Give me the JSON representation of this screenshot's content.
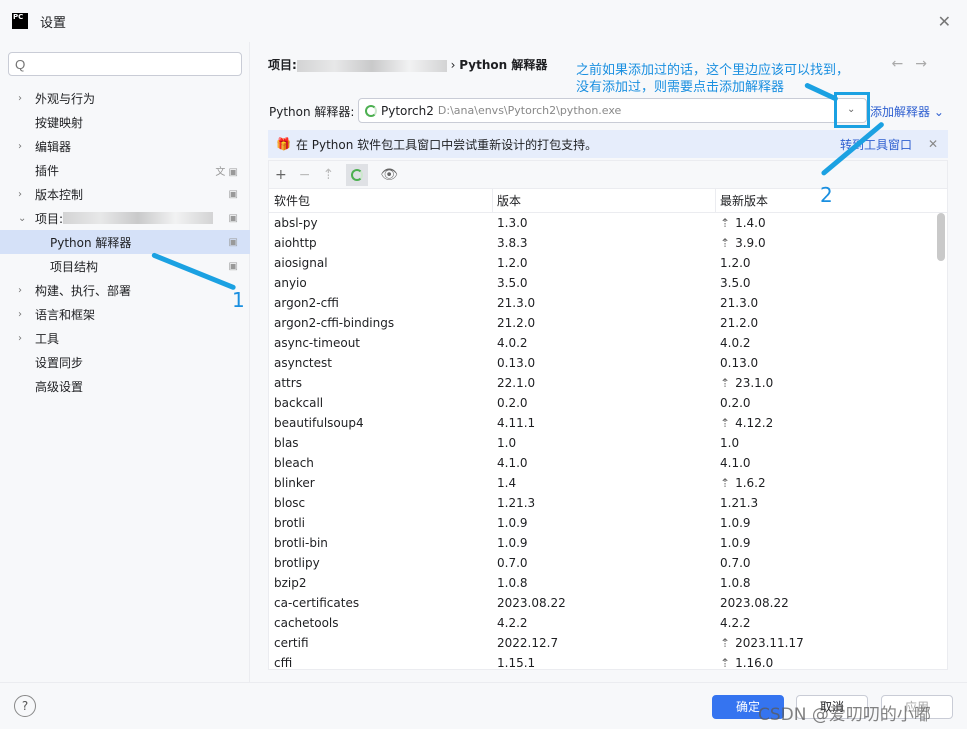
{
  "window": {
    "title": "设置",
    "logo": "PC"
  },
  "search": {
    "placeholder": "Q"
  },
  "sidebar": {
    "items": [
      {
        "label": "外观与行为",
        "chev": "›",
        "indent": 0
      },
      {
        "label": "按键映射",
        "chev": "",
        "indent": 0
      },
      {
        "label": "编辑器",
        "chev": "›",
        "indent": 0
      },
      {
        "label": "插件",
        "chev": "",
        "indent": 0,
        "right": "文 ▣"
      },
      {
        "label": "版本控制",
        "chev": "›",
        "indent": 0,
        "right": "▣"
      },
      {
        "label": "项目:",
        "chev": "⌄",
        "indent": 0,
        "right": "▣",
        "blur": true
      },
      {
        "label": "Python 解释器",
        "chev": "",
        "indent": 1,
        "right": "▣",
        "selected": true
      },
      {
        "label": "项目结构",
        "chev": "",
        "indent": 1,
        "right": "▣"
      },
      {
        "label": "构建、执行、部署",
        "chev": "›",
        "indent": 0
      },
      {
        "label": "语言和框架",
        "chev": "›",
        "indent": 0
      },
      {
        "label": "工具",
        "chev": "›",
        "indent": 0
      },
      {
        "label": "设置同步",
        "chev": "",
        "indent": 0
      },
      {
        "label": "高级设置",
        "chev": "",
        "indent": 0
      }
    ]
  },
  "breadcrumb": {
    "project": "项目:",
    "current": "Python 解释器"
  },
  "annotation": {
    "note1": "之前如果添加过的话，这个里边应该可以找到，",
    "note2": "没有添加过，则需要点击添加解释器",
    "num1": "1",
    "num2": "2"
  },
  "interpreter": {
    "label": "Python 解释器:",
    "name": "Pytorch2",
    "path": "D:\\ana\\envs\\Pytorch2\\python.exe",
    "add": "添加解释器"
  },
  "banner": {
    "text": "在 Python 软件包工具窗口中尝试重新设计的打包支持。",
    "link": "转到工具窗口"
  },
  "table": {
    "headers": [
      "软件包",
      "版本",
      "最新版本"
    ],
    "rows": [
      [
        "absl-py",
        "1.3.0",
        "1.4.0",
        true
      ],
      [
        "aiohttp",
        "3.8.3",
        "3.9.0",
        true
      ],
      [
        "aiosignal",
        "1.2.0",
        "1.2.0",
        false
      ],
      [
        "anyio",
        "3.5.0",
        "3.5.0",
        false
      ],
      [
        "argon2-cffi",
        "21.3.0",
        "21.3.0",
        false
      ],
      [
        "argon2-cffi-bindings",
        "21.2.0",
        "21.2.0",
        false
      ],
      [
        "async-timeout",
        "4.0.2",
        "4.0.2",
        false
      ],
      [
        "asynctest",
        "0.13.0",
        "0.13.0",
        false
      ],
      [
        "attrs",
        "22.1.0",
        "23.1.0",
        true
      ],
      [
        "backcall",
        "0.2.0",
        "0.2.0",
        false
      ],
      [
        "beautifulsoup4",
        "4.11.1",
        "4.12.2",
        true
      ],
      [
        "blas",
        "1.0",
        "1.0",
        false
      ],
      [
        "bleach",
        "4.1.0",
        "4.1.0",
        false
      ],
      [
        "blinker",
        "1.4",
        "1.6.2",
        true
      ],
      [
        "blosc",
        "1.21.3",
        "1.21.3",
        false
      ],
      [
        "brotli",
        "1.0.9",
        "1.0.9",
        false
      ],
      [
        "brotli-bin",
        "1.0.9",
        "1.0.9",
        false
      ],
      [
        "brotlipy",
        "0.7.0",
        "0.7.0",
        false
      ],
      [
        "bzip2",
        "1.0.8",
        "1.0.8",
        false
      ],
      [
        "ca-certificates",
        "2023.08.22",
        "2023.08.22",
        false
      ],
      [
        "cachetools",
        "4.2.2",
        "4.2.2",
        false
      ],
      [
        "certifi",
        "2022.12.7",
        "2023.11.17",
        true
      ],
      [
        "cffi",
        "1.15.1",
        "1.16.0",
        true
      ]
    ]
  },
  "footer": {
    "ok": "确定",
    "cancel": "取消",
    "apply": "应用",
    "help": "?"
  },
  "watermark": "CSDN @爱叨叨的小嘟",
  "colors": {
    "accent": "#3574f0",
    "annotation": "#1ba1e2",
    "selected": "#d5e1f8"
  }
}
